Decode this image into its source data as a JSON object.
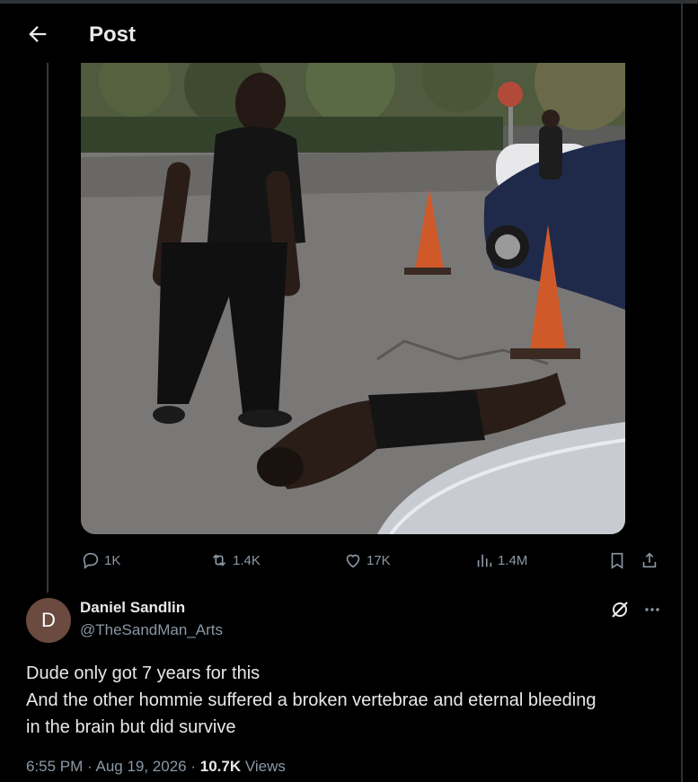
{
  "header": {
    "title": "Post",
    "back_icon": "arrow-left-icon"
  },
  "media": {
    "kind": "video-still"
  },
  "actions": {
    "replies": "1K",
    "reposts": "1.4K",
    "likes": "17K",
    "views": "1.4M"
  },
  "author": {
    "avatar_letter": "D",
    "name": "Daniel Sandlin",
    "handle": "@TheSandMan_Arts"
  },
  "post": {
    "lines": [
      "Dude only got 7 years for this",
      "And the other hommie suffered a broken vertebrae and eternal bleeding",
      "in the brain but did survive"
    ]
  },
  "meta": {
    "time": "6:55 PM",
    "sep1": " · ",
    "date": "Aug 19, 2026",
    "sep2": " · ",
    "views_count": "10.7K",
    "views_label": " Views"
  },
  "colors": {
    "background": "#000000",
    "text": "#e7e9ea",
    "muted": "#8b98a5",
    "divider": "#2f3336"
  }
}
